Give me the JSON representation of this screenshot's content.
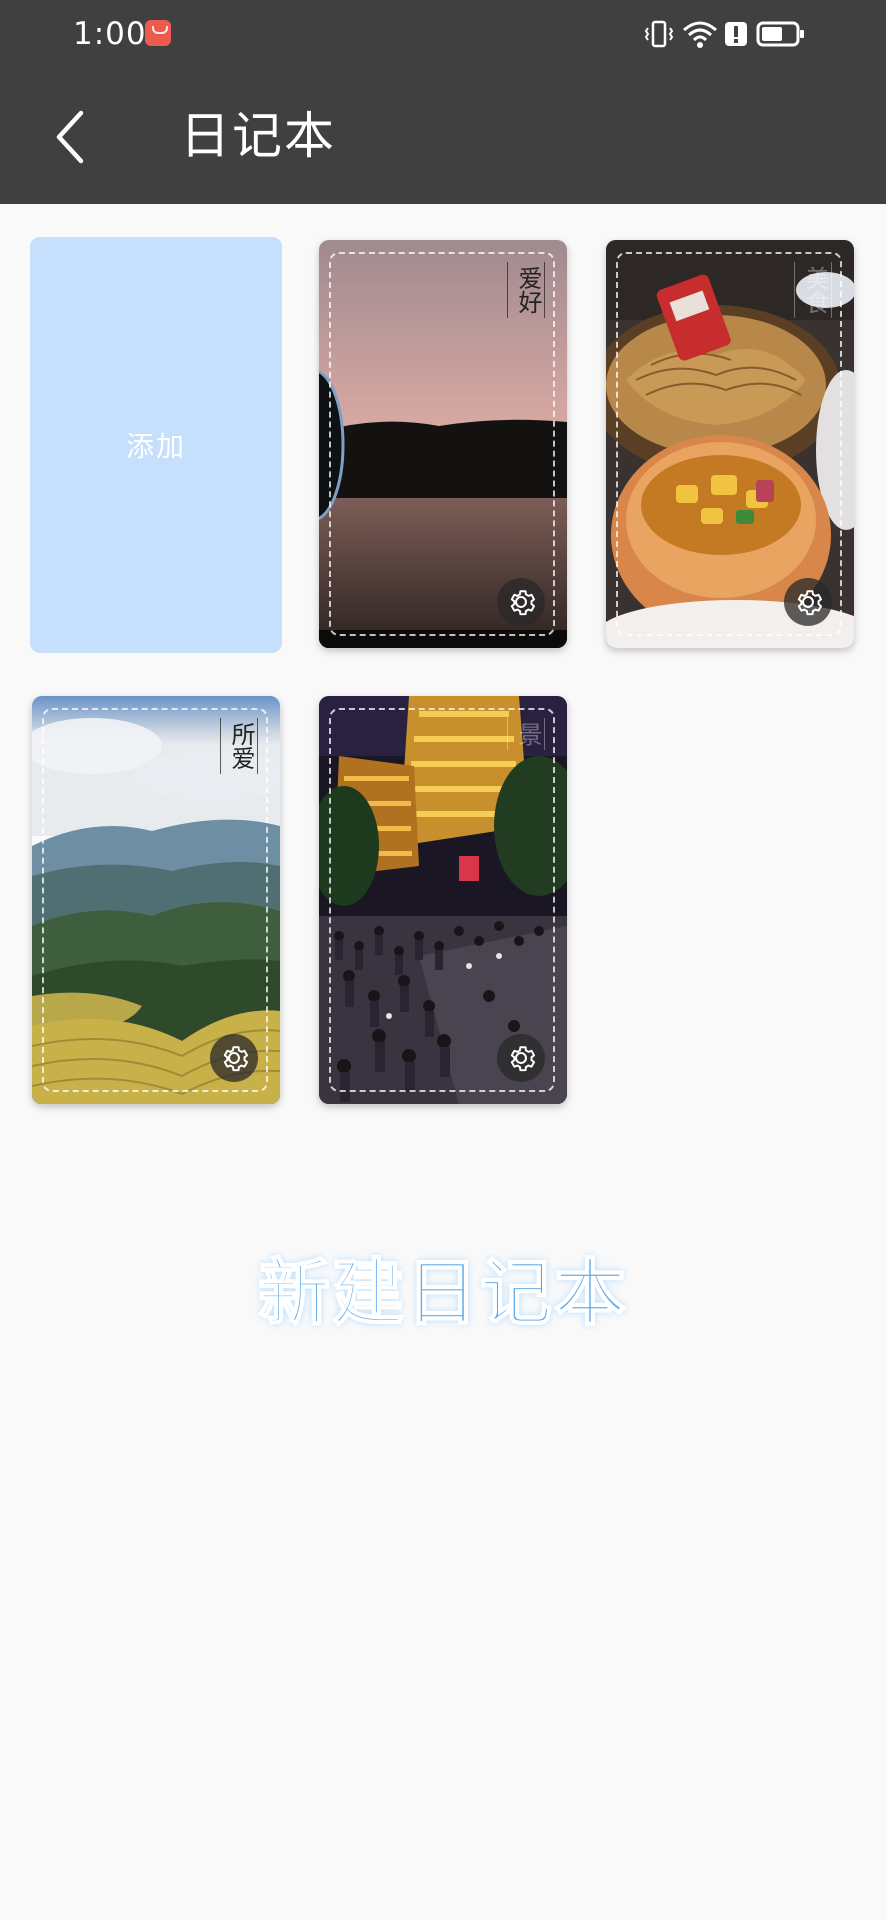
{
  "status_bar": {
    "time": "1:00",
    "icons": [
      "app-badge-icon",
      "vibrate-icon",
      "wifi-icon",
      "alert-icon",
      "battery-icon"
    ]
  },
  "app_bar": {
    "title": "日记本",
    "back_icon": "chevron-left-icon"
  },
  "add_card": {
    "label": "添加",
    "color": "#c5dffc"
  },
  "notebooks": [
    {
      "label": "爱好",
      "scene": "sunset-lake",
      "settings_icon": "gear-icon"
    },
    {
      "label": "美食",
      "scene": "food-bread-bowl",
      "settings_icon": "gear-icon"
    },
    {
      "label": "所爱",
      "scene": "mountain-terraces",
      "settings_icon": "gear-icon"
    },
    {
      "label": "景",
      "scene": "night-street-crowd",
      "settings_icon": "gear-icon"
    }
  ],
  "promo": {
    "text": "新建日记本",
    "color": "#5aa8ec"
  },
  "colors": {
    "app_bar": "#404040",
    "background": "#f9f9fa"
  }
}
